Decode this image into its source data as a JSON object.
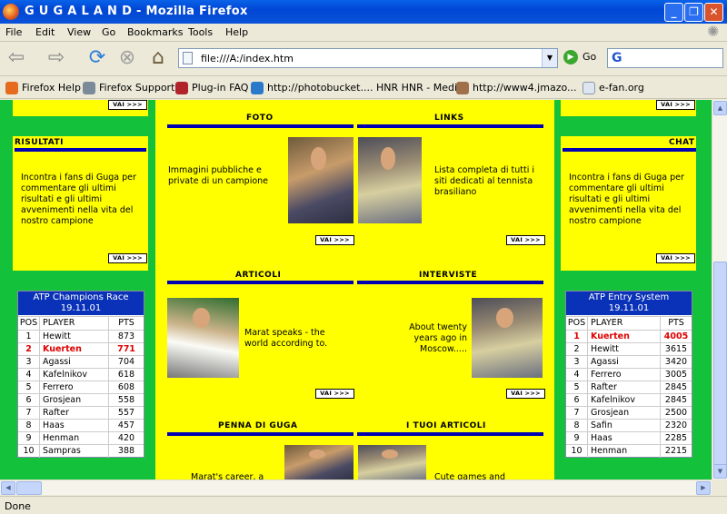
{
  "window": {
    "title": "G U G A L A N D - Mozilla Firefox",
    "minimize": "_",
    "restore": "❐",
    "close": "✕"
  },
  "menu": {
    "items": [
      "File",
      "Edit",
      "View",
      "Go",
      "Bookmarks",
      "Tools",
      "Help"
    ]
  },
  "nav": {
    "back": "⇦",
    "forward": "⇨",
    "reload": "⟳",
    "stop": "⊗",
    "home": "⌂",
    "url": "file:///A:/index.htm",
    "go": "Go",
    "search_logo": "G"
  },
  "bookmarks": [
    {
      "label": "Firefox Help",
      "color": "#e56b1f"
    },
    {
      "label": "Firefox Support",
      "color": "#7a8a99"
    },
    {
      "label": "Plug-in FAQ",
      "color": "#b0232b"
    },
    {
      "label": "http://photobucket....",
      "color": "#2b79c9"
    },
    {
      "label": "HNR HNR - Media",
      "color": "#ece9d8"
    },
    {
      "label": "http://www4.jmazo...",
      "color": "#a0704a"
    },
    {
      "label": "e-fan.org",
      "color": "#dde5f0"
    }
  ],
  "page": {
    "left": {
      "vai_top": "VAI >>>",
      "risultati_title": "RISULTATI",
      "risultati_text": "Incontra i fans di Guga per commentare gli ultimi risultati e gli ultimi avvenimenti nella vita del nostro campione",
      "vai": "VAI >>>"
    },
    "right": {
      "vai_top": "VAI >>>",
      "chat_title": "CHAT",
      "chat_text": "Incontra i fans di Guga per commentare gli ultimi risultati e gli ultimi avvenimenti nella vita del nostro campione",
      "vai": "VAI >>>"
    },
    "foto": {
      "title": "FOTO",
      "text": "Immagini pubbliche e private di un campione"
    },
    "links": {
      "title": "LINKS",
      "text": "Lista completa di tutti i siti dedicati al tennista brasiliano",
      "vai": "VAI >>>"
    },
    "articoli": {
      "title": "ARTICOLI",
      "text": "Marat speaks - the world according to.",
      "vai": "VAI >>>"
    },
    "interviste": {
      "title": "INTERVISTE",
      "text": "About twenty years ago in Moscow.....",
      "vai": "VAI >>>"
    },
    "penna": {
      "title": "PENNA DI GUGA",
      "text": "Marat's career, a"
    },
    "tuoi": {
      "title": "I TUOI ARTICOLI",
      "text": "Cute games and"
    },
    "race": {
      "title": "ATP Champions Race",
      "date": "19.11.01",
      "headers": [
        "POS",
        "PLAYER",
        "PTS"
      ],
      "rows": [
        [
          "1",
          "Hewitt",
          "873"
        ],
        [
          "2",
          "Kuerten",
          "771"
        ],
        [
          "3",
          "Agassi",
          "704"
        ],
        [
          "4",
          "Kafelnikov",
          "618"
        ],
        [
          "5",
          "Ferrero",
          "608"
        ],
        [
          "6",
          "Grosjean",
          "558"
        ],
        [
          "7",
          "Rafter",
          "557"
        ],
        [
          "8",
          "Haas",
          "457"
        ],
        [
          "9",
          "Henman",
          "420"
        ],
        [
          "10",
          "Sampras",
          "388"
        ]
      ],
      "highlight": "Kuerten"
    },
    "entry": {
      "title": "ATP Entry System",
      "date": "19.11.01",
      "headers": [
        "POS",
        "PLAYER",
        "PTS"
      ],
      "rows": [
        [
          "1",
          "Kuerten",
          "4005"
        ],
        [
          "2",
          "Hewitt",
          "3615"
        ],
        [
          "3",
          "Agassi",
          "3420"
        ],
        [
          "4",
          "Ferrero",
          "3005"
        ],
        [
          "5",
          "Rafter",
          "2845"
        ],
        [
          "6",
          "Kafelnikov",
          "2845"
        ],
        [
          "7",
          "Grosjean",
          "2500"
        ],
        [
          "8",
          "Safin",
          "2320"
        ],
        [
          "9",
          "Haas",
          "2285"
        ],
        [
          "10",
          "Henman",
          "2215"
        ]
      ],
      "highlight": "Kuerten"
    }
  },
  "status": "Done"
}
